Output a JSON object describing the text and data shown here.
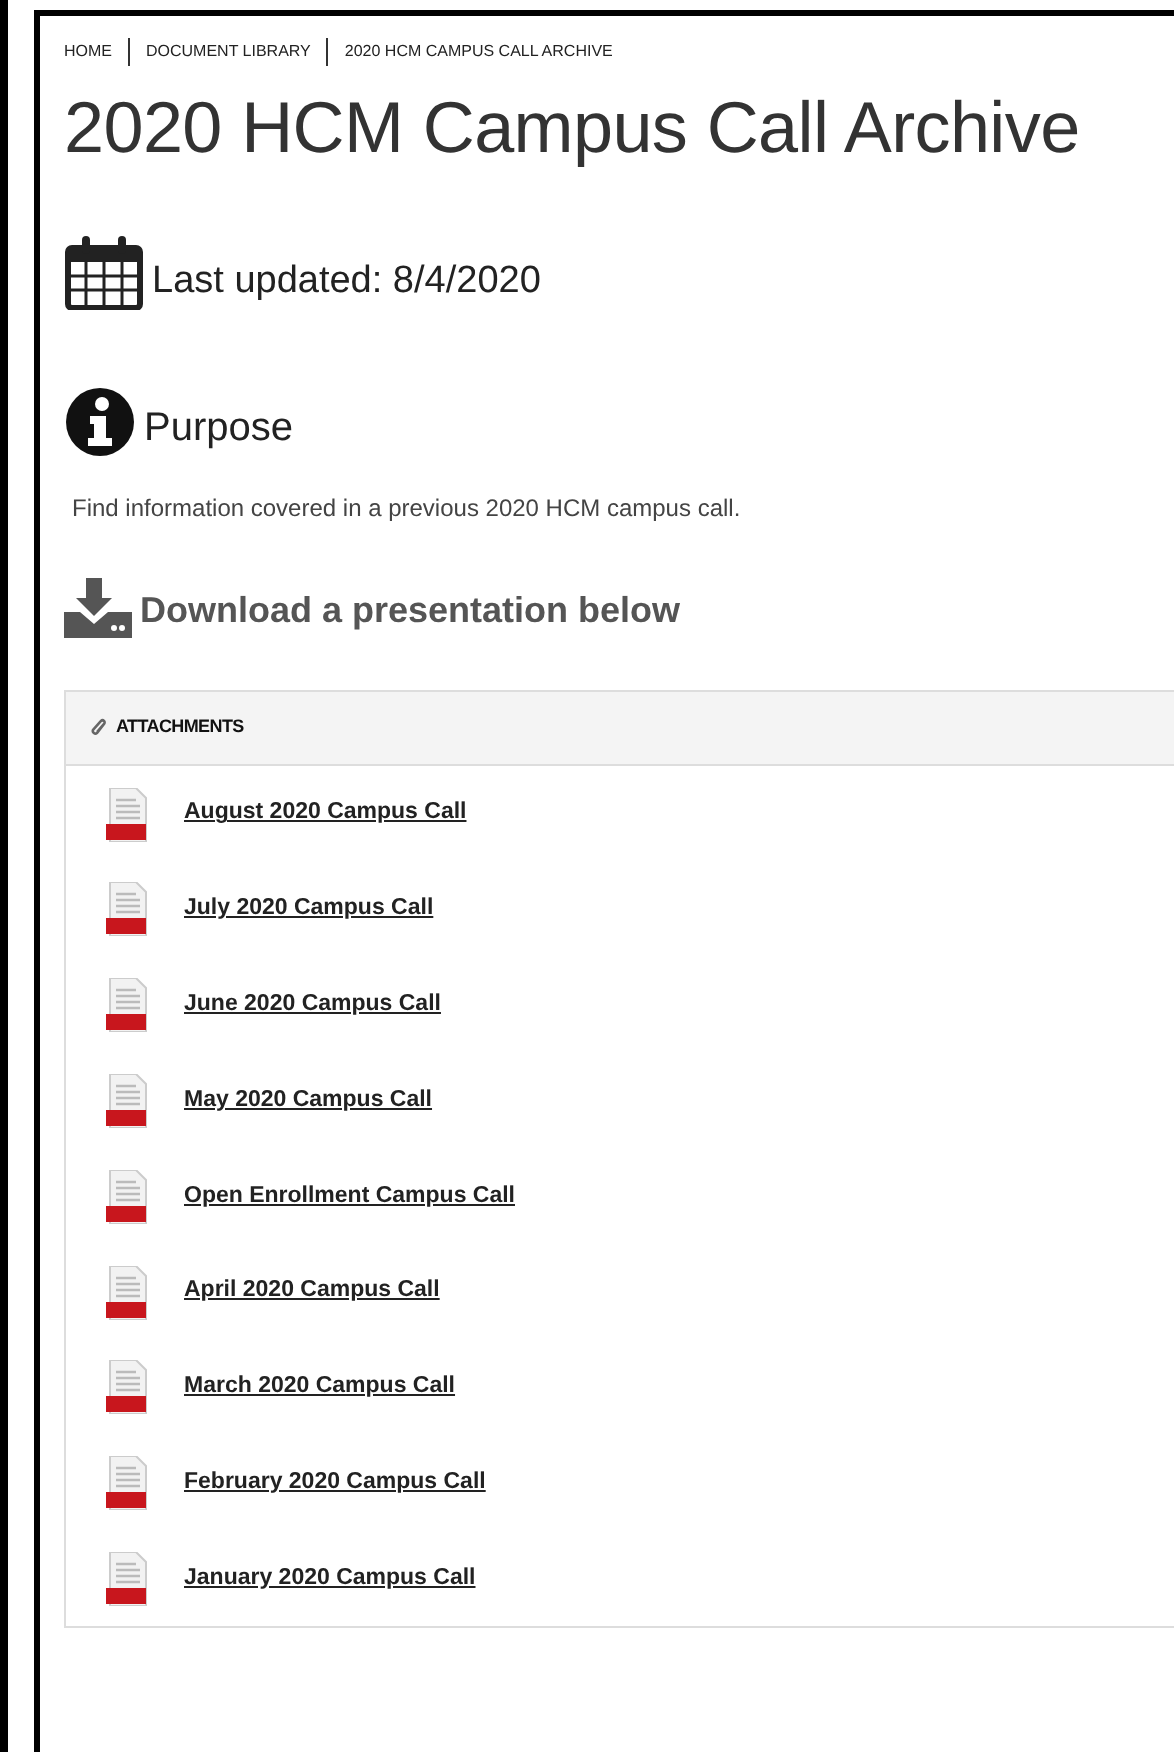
{
  "breadcrumb": [
    "HOME",
    "DOCUMENT LIBRARY",
    "2020 HCM CAMPUS CALL ARCHIVE"
  ],
  "title": "2020 HCM Campus Call Archive",
  "last_updated": "Last updated: 8/4/2020",
  "purpose": {
    "heading": "Purpose",
    "text": "Find information covered in a previous 2020 HCM campus call."
  },
  "download_heading": "Download a presentation below",
  "attachments": {
    "heading": "ATTACHMENTS",
    "files": [
      {
        "name": "August 2020 Campus Call"
      },
      {
        "name": "July 2020 Campus Call"
      },
      {
        "name": "June 2020 Campus Call"
      },
      {
        "name": "May 2020 Campus Call"
      },
      {
        "name": "Open Enrollment Campus Call"
      },
      {
        "name": "April 2020 Campus Call"
      },
      {
        "name": "March 2020 Campus Call"
      },
      {
        "name": "February 2020 Campus Call"
      },
      {
        "name": "January 2020 Campus Call"
      }
    ]
  }
}
